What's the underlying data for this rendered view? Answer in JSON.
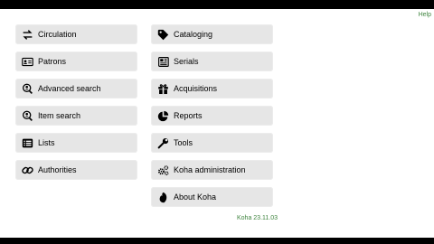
{
  "header": {
    "help_label": "Help"
  },
  "left_column": [
    {
      "label": "Circulation",
      "icon": "exchange-arrows-icon"
    },
    {
      "label": "Patrons",
      "icon": "id-card-icon"
    },
    {
      "label": "Advanced search",
      "icon": "search-people-icon"
    },
    {
      "label": "Item search",
      "icon": "search-people-icon"
    },
    {
      "label": "Lists",
      "icon": "list-icon"
    },
    {
      "label": "Authorities",
      "icon": "link-icon"
    }
  ],
  "right_column": [
    {
      "label": "Cataloging",
      "icon": "tag-icon"
    },
    {
      "label": "Serials",
      "icon": "newspaper-icon"
    },
    {
      "label": "Acquisitions",
      "icon": "gift-icon"
    },
    {
      "label": "Reports",
      "icon": "pie-chart-icon"
    },
    {
      "label": "Tools",
      "icon": "wrench-icon"
    },
    {
      "label": "Koha administration",
      "icon": "gears-icon"
    },
    {
      "label": "About Koha",
      "icon": "koha-logo-icon"
    }
  ],
  "footer": {
    "version": "Koha 23.11.03"
  },
  "colors": {
    "tile_bg": "#e6e6e6",
    "accent_green": "#408540"
  }
}
